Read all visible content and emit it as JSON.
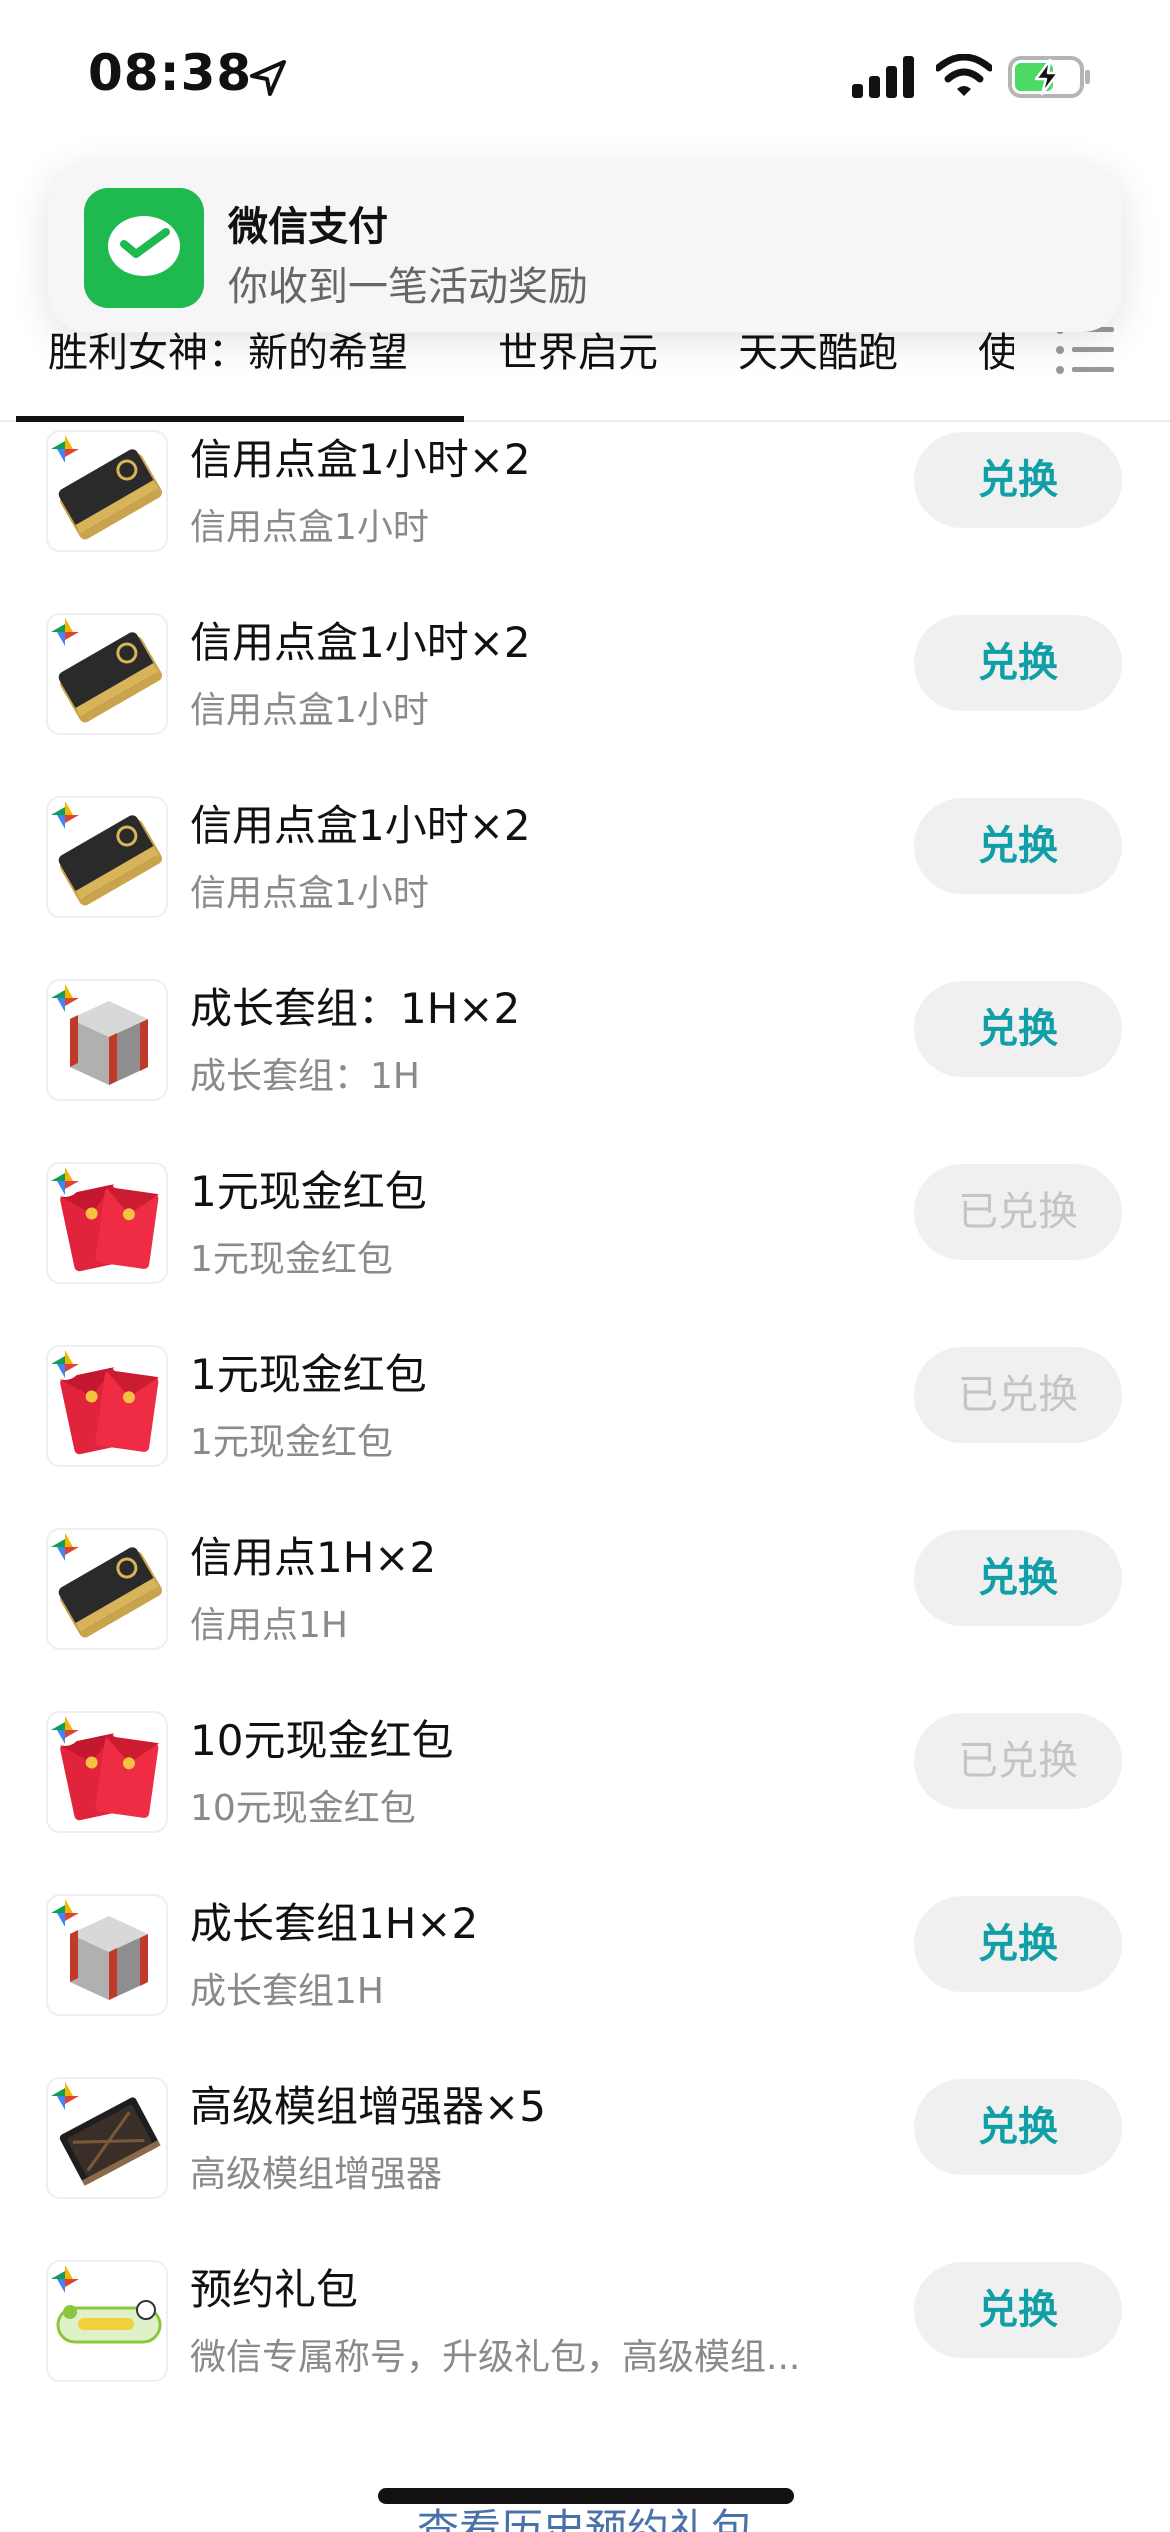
{
  "status_bar": {
    "time": "08:38",
    "icons": [
      "location-arrow-icon",
      "cellular-signal-icon",
      "wifi-icon",
      "battery-charging-icon"
    ],
    "battery_color": "#4cd964"
  },
  "notification": {
    "app_icon": "wechat-pay-icon",
    "title": "微信支付",
    "body": "你收到一笔活动奖励",
    "accent": "#1fba4f"
  },
  "tabs": [
    "胜利女神：新的希望",
    "世界启元",
    "天天酷跑",
    "使"
  ],
  "tab_menu_icon": "list-menu-icon",
  "colors": {
    "button_text": "#109fa6",
    "button_done_text": "#c4c4c4",
    "button_bg": "#f0f0f0"
  },
  "items": [
    {
      "title": "信用点盒1小时×2",
      "subtitle": "信用点盒1小时",
      "button": "兑换",
      "icon": "credit-card-icon"
    },
    {
      "title": "信用点盒1小时×2",
      "subtitle": "信用点盒1小时",
      "button": "兑换",
      "icon": "credit-card-icon"
    },
    {
      "title": "信用点盒1小时×2",
      "subtitle": "信用点盒1小时",
      "button": "兑换",
      "icon": "credit-card-icon"
    },
    {
      "title": "成长套组：1H×2",
      "subtitle": "成长套组：1H",
      "button": "兑换",
      "icon": "supply-crate-icon"
    },
    {
      "title": "1元现金红包",
      "subtitle": "1元现金红包",
      "button": "已兑换",
      "icon": "red-envelope-icon"
    },
    {
      "title": "1元现金红包",
      "subtitle": "1元现金红包",
      "button": "已兑换",
      "icon": "red-envelope-icon"
    },
    {
      "title": "信用点1H×2",
      "subtitle": "信用点1H",
      "button": "兑换",
      "icon": "credit-card-icon"
    },
    {
      "title": "10元现金红包",
      "subtitle": "10元现金红包",
      "button": "已兑换",
      "icon": "red-envelope-icon"
    },
    {
      "title": "成长套组1H×2",
      "subtitle": "成长套组1H",
      "button": "兑换",
      "icon": "supply-crate-icon"
    },
    {
      "title": "高级模组增强器×5",
      "subtitle": "高级模组增强器",
      "button": "兑换",
      "icon": "module-enhancer-icon"
    },
    {
      "title": "预约礼包",
      "subtitle": "微信专属称号，升级礼包，高级模组...",
      "button": "兑换",
      "icon": "reservation-gift-icon"
    }
  ],
  "footer": {
    "history_link": "查看历史预约礼包"
  }
}
